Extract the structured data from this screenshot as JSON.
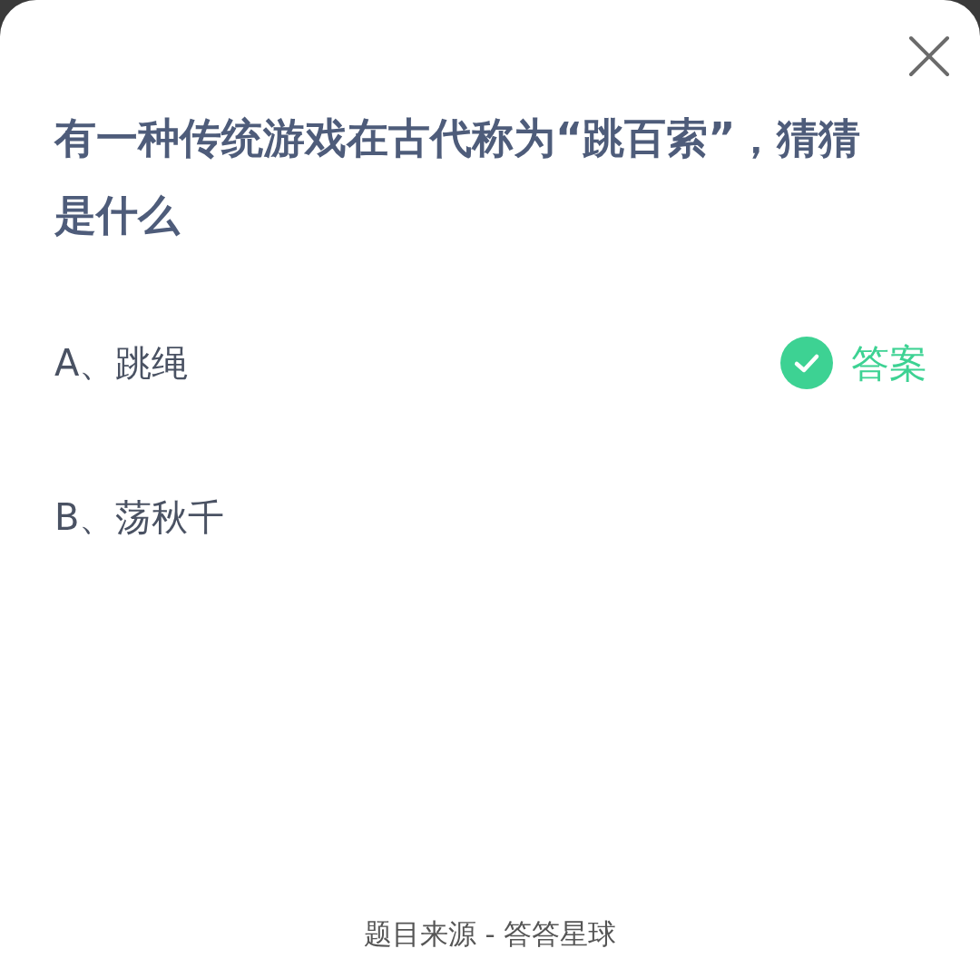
{
  "question": "有一种传统游戏在古代称为“跳百索”，猜猜是什么",
  "options": [
    {
      "label": "A、跳绳",
      "correct": true
    },
    {
      "label": "B、荡秋千",
      "correct": false
    }
  ],
  "answer_badge": "答案",
  "footer": "题目来源 - 答答星球"
}
